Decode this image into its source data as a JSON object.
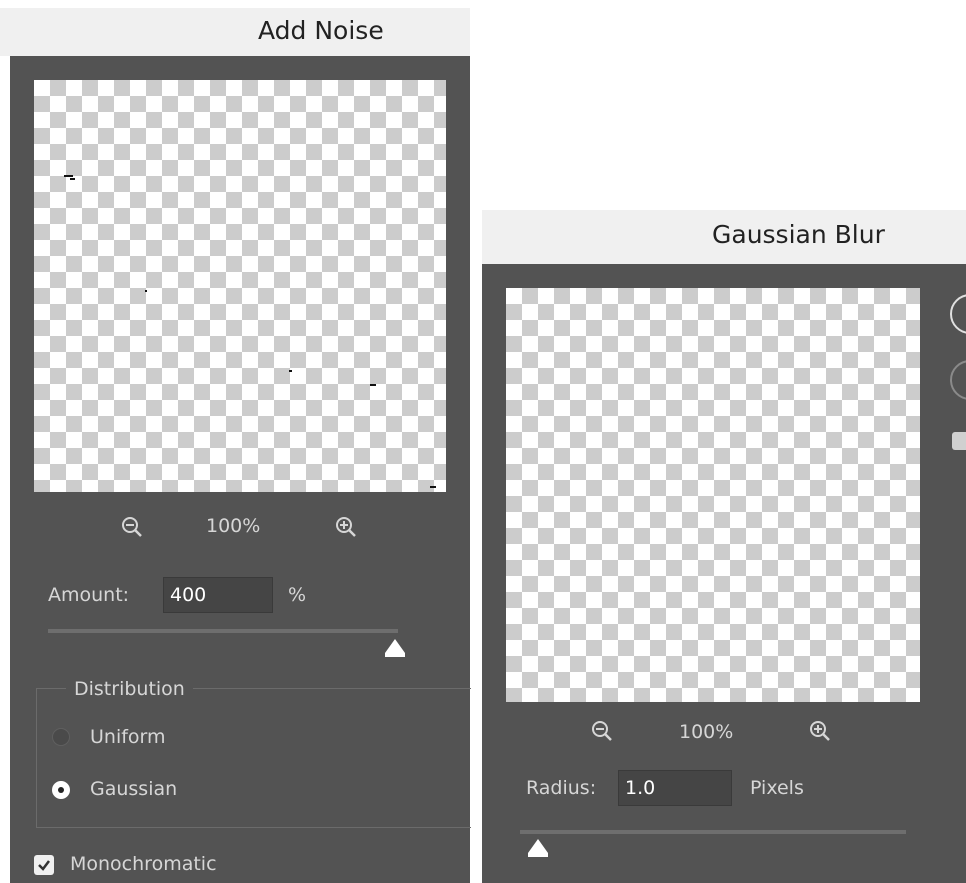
{
  "add_noise": {
    "title": "Add Noise",
    "zoom_level": "100%",
    "amount_label": "Amount:",
    "amount_value": "400",
    "amount_unit": "%",
    "amount_slider_fraction": 1.0,
    "distribution_label": "Distribution",
    "options": [
      {
        "label": "Uniform",
        "selected": false
      },
      {
        "label": "Gaussian",
        "selected": true
      }
    ],
    "monochromatic_label": "Monochromatic",
    "monochromatic_checked": true
  },
  "gaussian_blur": {
    "title": "Gaussian Blur",
    "zoom_level": "100%",
    "radius_label": "Radius:",
    "radius_value": "1.0",
    "radius_unit": "Pixels",
    "radius_slider_fraction": 0.0
  },
  "colors": {
    "panel": "#535353",
    "field": "#454545",
    "text": "#d6d6d6",
    "title_bar": "#f0f0f0"
  }
}
